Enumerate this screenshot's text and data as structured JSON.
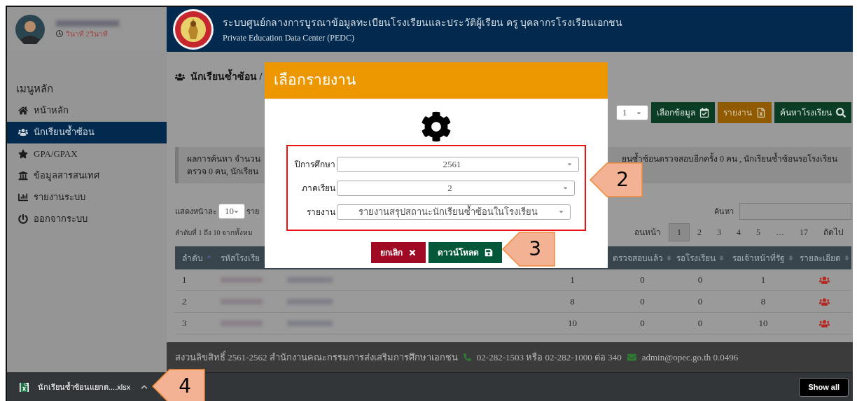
{
  "sidebar": {
    "clock": "วินาที 2วินาที",
    "menu_title": "เมนูหลัก",
    "items": [
      {
        "label": "หน้าหลัก",
        "selected": false
      },
      {
        "label": "นักเรียนซ้ำซ้อน",
        "selected": true
      },
      {
        "label": "GPA/GPAX",
        "selected": false
      },
      {
        "label": "ข้อมูลสารสนเทศ",
        "selected": false
      },
      {
        "label": "รายงานระบบ",
        "selected": false
      },
      {
        "label": "ออกจากระบบ",
        "selected": false
      }
    ]
  },
  "header": {
    "title": "ระบบศูนย์กลางการบูรณาข้อมูลทะเบียนโรงเรียนและประวัติผู้เรียน ครู บุคลากรโรงเรียนเอกชน",
    "subtitle": "Private Education Data Center (PEDC)"
  },
  "page": {
    "title": "นักเรียนซ้ำซ้อน /",
    "page_select": "1",
    "buttons": [
      {
        "label": "เลือกข้อมูล",
        "kind": "calendar"
      },
      {
        "label": "รายงาน",
        "kind": "excel"
      },
      {
        "label": "ค้นหาโรงเรียน",
        "kind": "search"
      }
    ],
    "info_left": [
      "ผลการค้นหา จำนวน",
      "ตรวจ 0 คน, นักเรียน"
    ],
    "info_right": "ยนซ้ำซ้อนตรวจสอบอีกครั้ง 0 คน , นักเรียนซ้ำซ้อนรอโรงเรียน",
    "show_label": "แสดงหน้าละ",
    "show_value": "10",
    "show_suffix": "ราย",
    "search_label": "ค้นหา",
    "range": "ลำดับที่ 1 ถึง 10 จากทั้งหม",
    "pagination": [
      {
        "label": "อนหน้า",
        "selected": false
      },
      {
        "label": "1",
        "selected": true
      },
      {
        "label": "2",
        "selected": false
      },
      {
        "label": "3",
        "selected": false
      },
      {
        "label": "4",
        "selected": false
      },
      {
        "label": "5",
        "selected": false
      },
      {
        "label": "…",
        "selected": false
      },
      {
        "label": "17",
        "selected": false
      },
      {
        "label": "ถัดไป",
        "selected": false
      }
    ]
  },
  "table": {
    "columns": [
      "ลำดับ",
      "รหัสโรงเรีย",
      "",
      "",
      "ตรวจสอบแล้ว",
      "รอโรงเรียน",
      "รอเจ้าหน้าที่รัฐ",
      "รายละเอียด"
    ],
    "rows": [
      {
        "index": "1",
        "column_4": "1",
        "checked": "0",
        "waiting_school": "0",
        "waiting_officer": "1"
      },
      {
        "index": "2",
        "column_4": "8",
        "checked": "0",
        "waiting_school": "0",
        "waiting_officer": "8"
      },
      {
        "index": "3",
        "column_4": "10",
        "checked": "0",
        "waiting_school": "0",
        "waiting_officer": "10"
      }
    ]
  },
  "footer": {
    "copyright": "สงวนลิขสิทธิ์ 2561-2562 สำนักงานคณะกรรมการส่งเสริมการศึกษาเอกชน",
    "phone": "02-282-1503 หรือ 02-282-1000 ต่อ 340",
    "email": "admin@opec.go.th 0.0496"
  },
  "dialog": {
    "title": "เลือกรายงาน",
    "fields": [
      {
        "label": "ปีการศึกษา",
        "value": "2561"
      },
      {
        "label": "ภาคเรียน",
        "value": "2"
      },
      {
        "label": "รายงาน",
        "value": "รายงานสรุปสถานะนักเรียนซ้ำซ้อนในโรงเรียน"
      }
    ],
    "buttons": [
      {
        "label": "ยกเลิก",
        "kind": "cancel"
      },
      {
        "label": "ดาวน์โหลด",
        "kind": "save"
      }
    ]
  },
  "download_bar": {
    "file": "นักเรียนซ้ำซ้อนแยกต....xlsx",
    "show_all": "Show all"
  },
  "callouts": [
    "2",
    "3",
    "4"
  ]
}
